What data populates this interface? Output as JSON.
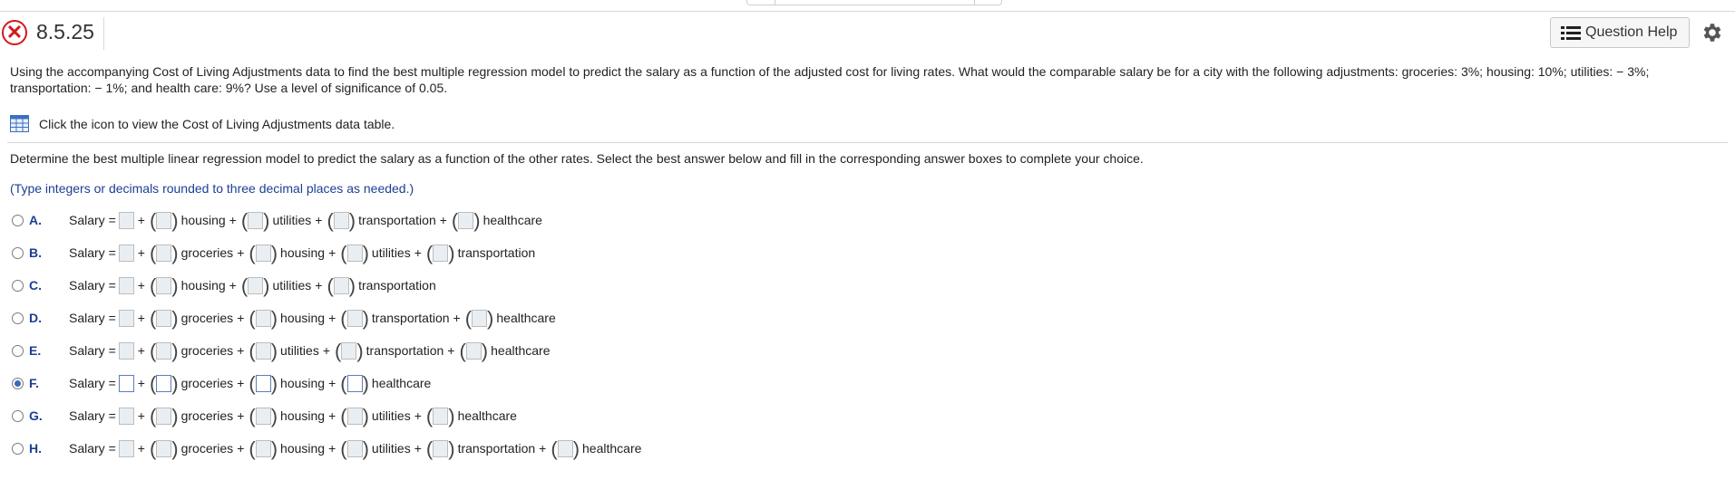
{
  "header": {
    "problem_id": "8.5.25",
    "help_label": "Question Help",
    "status": "incorrect"
  },
  "intro": {
    "text": "Using the accompanying Cost of Living Adjustments data to find the best multiple regression model to predict the salary as a function of the adjusted cost for living rates. What would the comparable salary be for a city with the following adjustments: groceries: 3%; housing: 10%; utilities: − 3%; transportation: − 1%; and health care: 9%? Use a level of significance of 0.05."
  },
  "data_link": {
    "text": "Click the icon to view the Cost of Living Adjustments data table."
  },
  "question": {
    "text": "Determine the best multiple linear regression model to predict the salary as a function of the other rates. Select the best answer below and fill in the corresponding answer boxes to complete your choice.",
    "hint": "(Type integers or decimals rounded to three decimal places as needed.)"
  },
  "labels": {
    "salary": "Salary",
    "equals": "=",
    "plus": "+"
  },
  "choices": [
    {
      "letter": "A.",
      "vars": [
        "housing",
        "utilities",
        "transportation",
        "healthcare"
      ],
      "selected": false
    },
    {
      "letter": "B.",
      "vars": [
        "groceries",
        "housing",
        "utilities",
        "transportation"
      ],
      "selected": false
    },
    {
      "letter": "C.",
      "vars": [
        "housing",
        "utilities",
        "transportation"
      ],
      "selected": false
    },
    {
      "letter": "D.",
      "vars": [
        "groceries",
        "housing",
        "transportation",
        "healthcare"
      ],
      "selected": false
    },
    {
      "letter": "E.",
      "vars": [
        "groceries",
        "utilities",
        "transportation",
        "healthcare"
      ],
      "selected": false
    },
    {
      "letter": "F.",
      "vars": [
        "groceries",
        "housing",
        "healthcare"
      ],
      "selected": true
    },
    {
      "letter": "G.",
      "vars": [
        "groceries",
        "housing",
        "utilities",
        "healthcare"
      ],
      "selected": false
    },
    {
      "letter": "H.",
      "vars": [
        "groceries",
        "housing",
        "utilities",
        "transportation",
        "healthcare"
      ],
      "selected": false
    }
  ],
  "colors": {
    "accent": "#1c3f94",
    "error": "#d11b1b",
    "radio_selected": "#3a68b8"
  }
}
